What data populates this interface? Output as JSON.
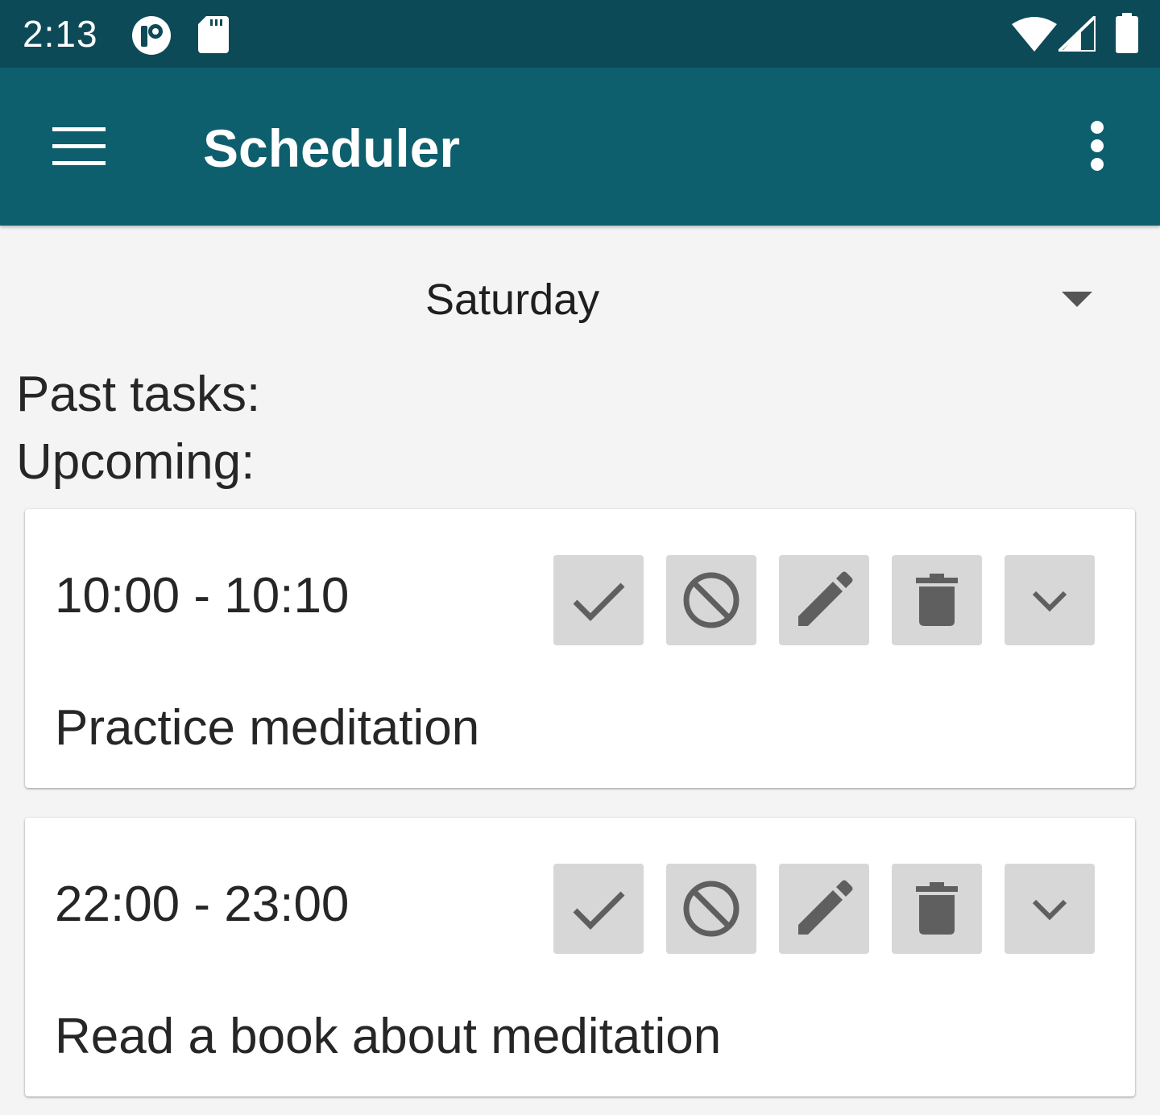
{
  "status_bar": {
    "time": "2:13",
    "left_icons": [
      "app-notification-icon",
      "sd-card-icon"
    ],
    "right_icons": [
      "wifi-icon",
      "signal-icon",
      "battery-icon"
    ]
  },
  "app_bar": {
    "title": "Scheduler",
    "menu_icon": "menu-icon",
    "overflow_icon": "more-vert-icon",
    "background": "#0e5f6e",
    "status_background": "#0d4a57"
  },
  "day_selector": {
    "selected": "Saturday",
    "icon": "dropdown-arrow-icon"
  },
  "sections": {
    "past_label": "Past tasks:",
    "upcoming_label": "Upcoming:"
  },
  "tasks": [
    {
      "time": "10:00 - 10:10",
      "title": "Practice meditation",
      "actions": [
        "check-icon",
        "block-icon",
        "edit-icon",
        "delete-icon",
        "expand-icon"
      ]
    },
    {
      "time": "22:00 - 23:00",
      "title": "Read a book about meditation",
      "actions": [
        "check-icon",
        "block-icon",
        "edit-icon",
        "delete-icon",
        "expand-icon"
      ]
    }
  ],
  "colors": {
    "action_button_bg": "#d7d7d7",
    "action_icon": "#5f5f5f",
    "page_background": "#f4f4f4"
  }
}
